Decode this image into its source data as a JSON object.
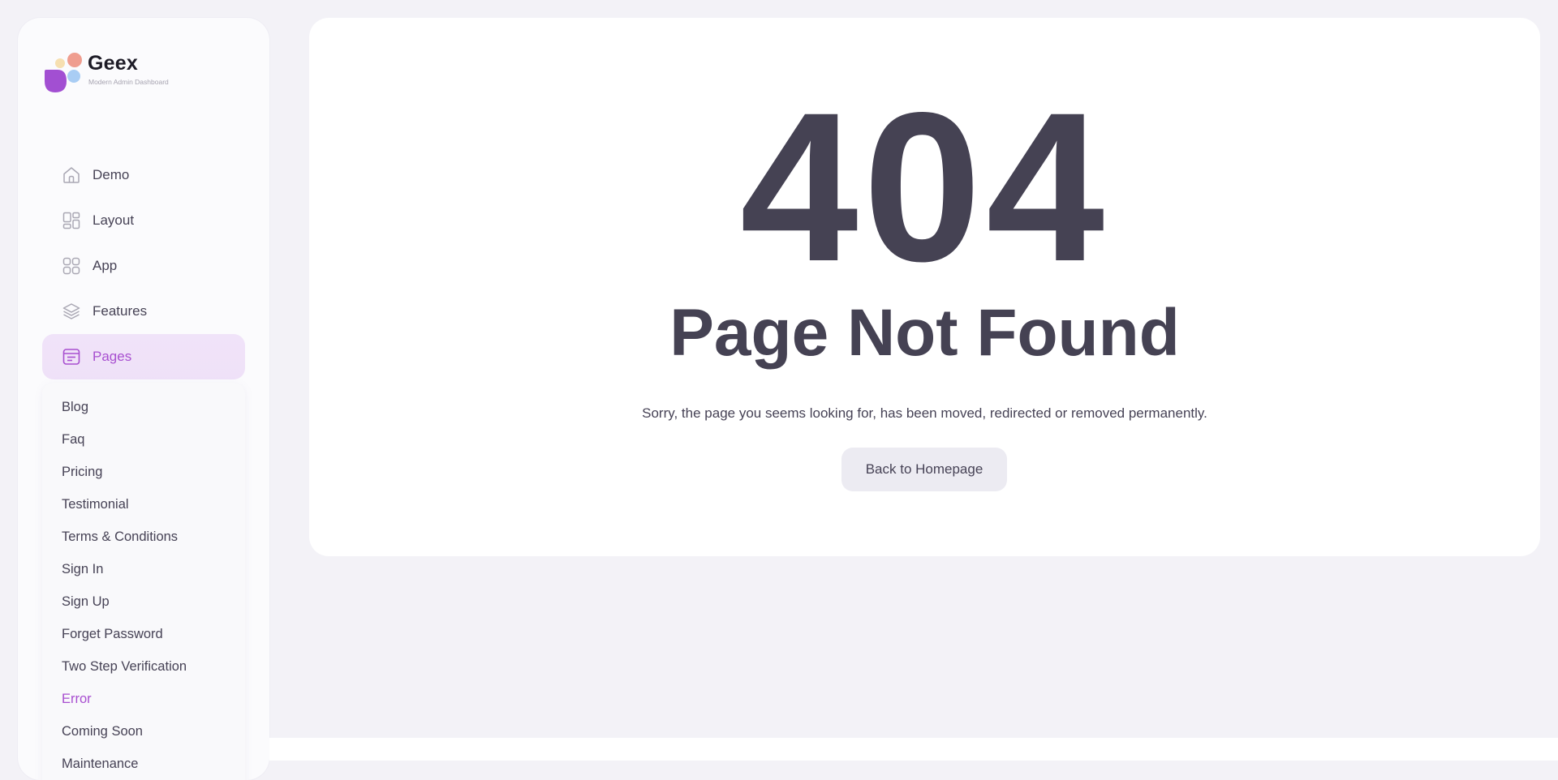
{
  "brand": {
    "name": "Geex",
    "tagline": "Modern Admin Dashboard"
  },
  "nav": {
    "items": [
      {
        "label": "Demo",
        "icon": "home-icon"
      },
      {
        "label": "Layout",
        "icon": "layout-icon"
      },
      {
        "label": "App",
        "icon": "apps-grid-icon"
      },
      {
        "label": "Features",
        "icon": "layers-icon"
      },
      {
        "label": "Pages",
        "icon": "pages-icon",
        "active": true
      }
    ]
  },
  "submenu": {
    "items": [
      "Blog",
      "Faq",
      "Pricing",
      "Testimonial",
      "Terms & Conditions",
      "Sign In",
      "Sign Up",
      "Forget Password",
      "Two Step Verification",
      "Error",
      "Coming Soon",
      "Maintenance"
    ],
    "active": "Error"
  },
  "error": {
    "code": "404",
    "title": "Page Not Found",
    "description": "Sorry, the page you seems looking for, has been moved, redirected or removed permanently.",
    "button_label": "Back to Homepage"
  },
  "colors": {
    "accent": "#a84fd0",
    "text_dark": "#454253",
    "background": "#f3f2f7"
  }
}
